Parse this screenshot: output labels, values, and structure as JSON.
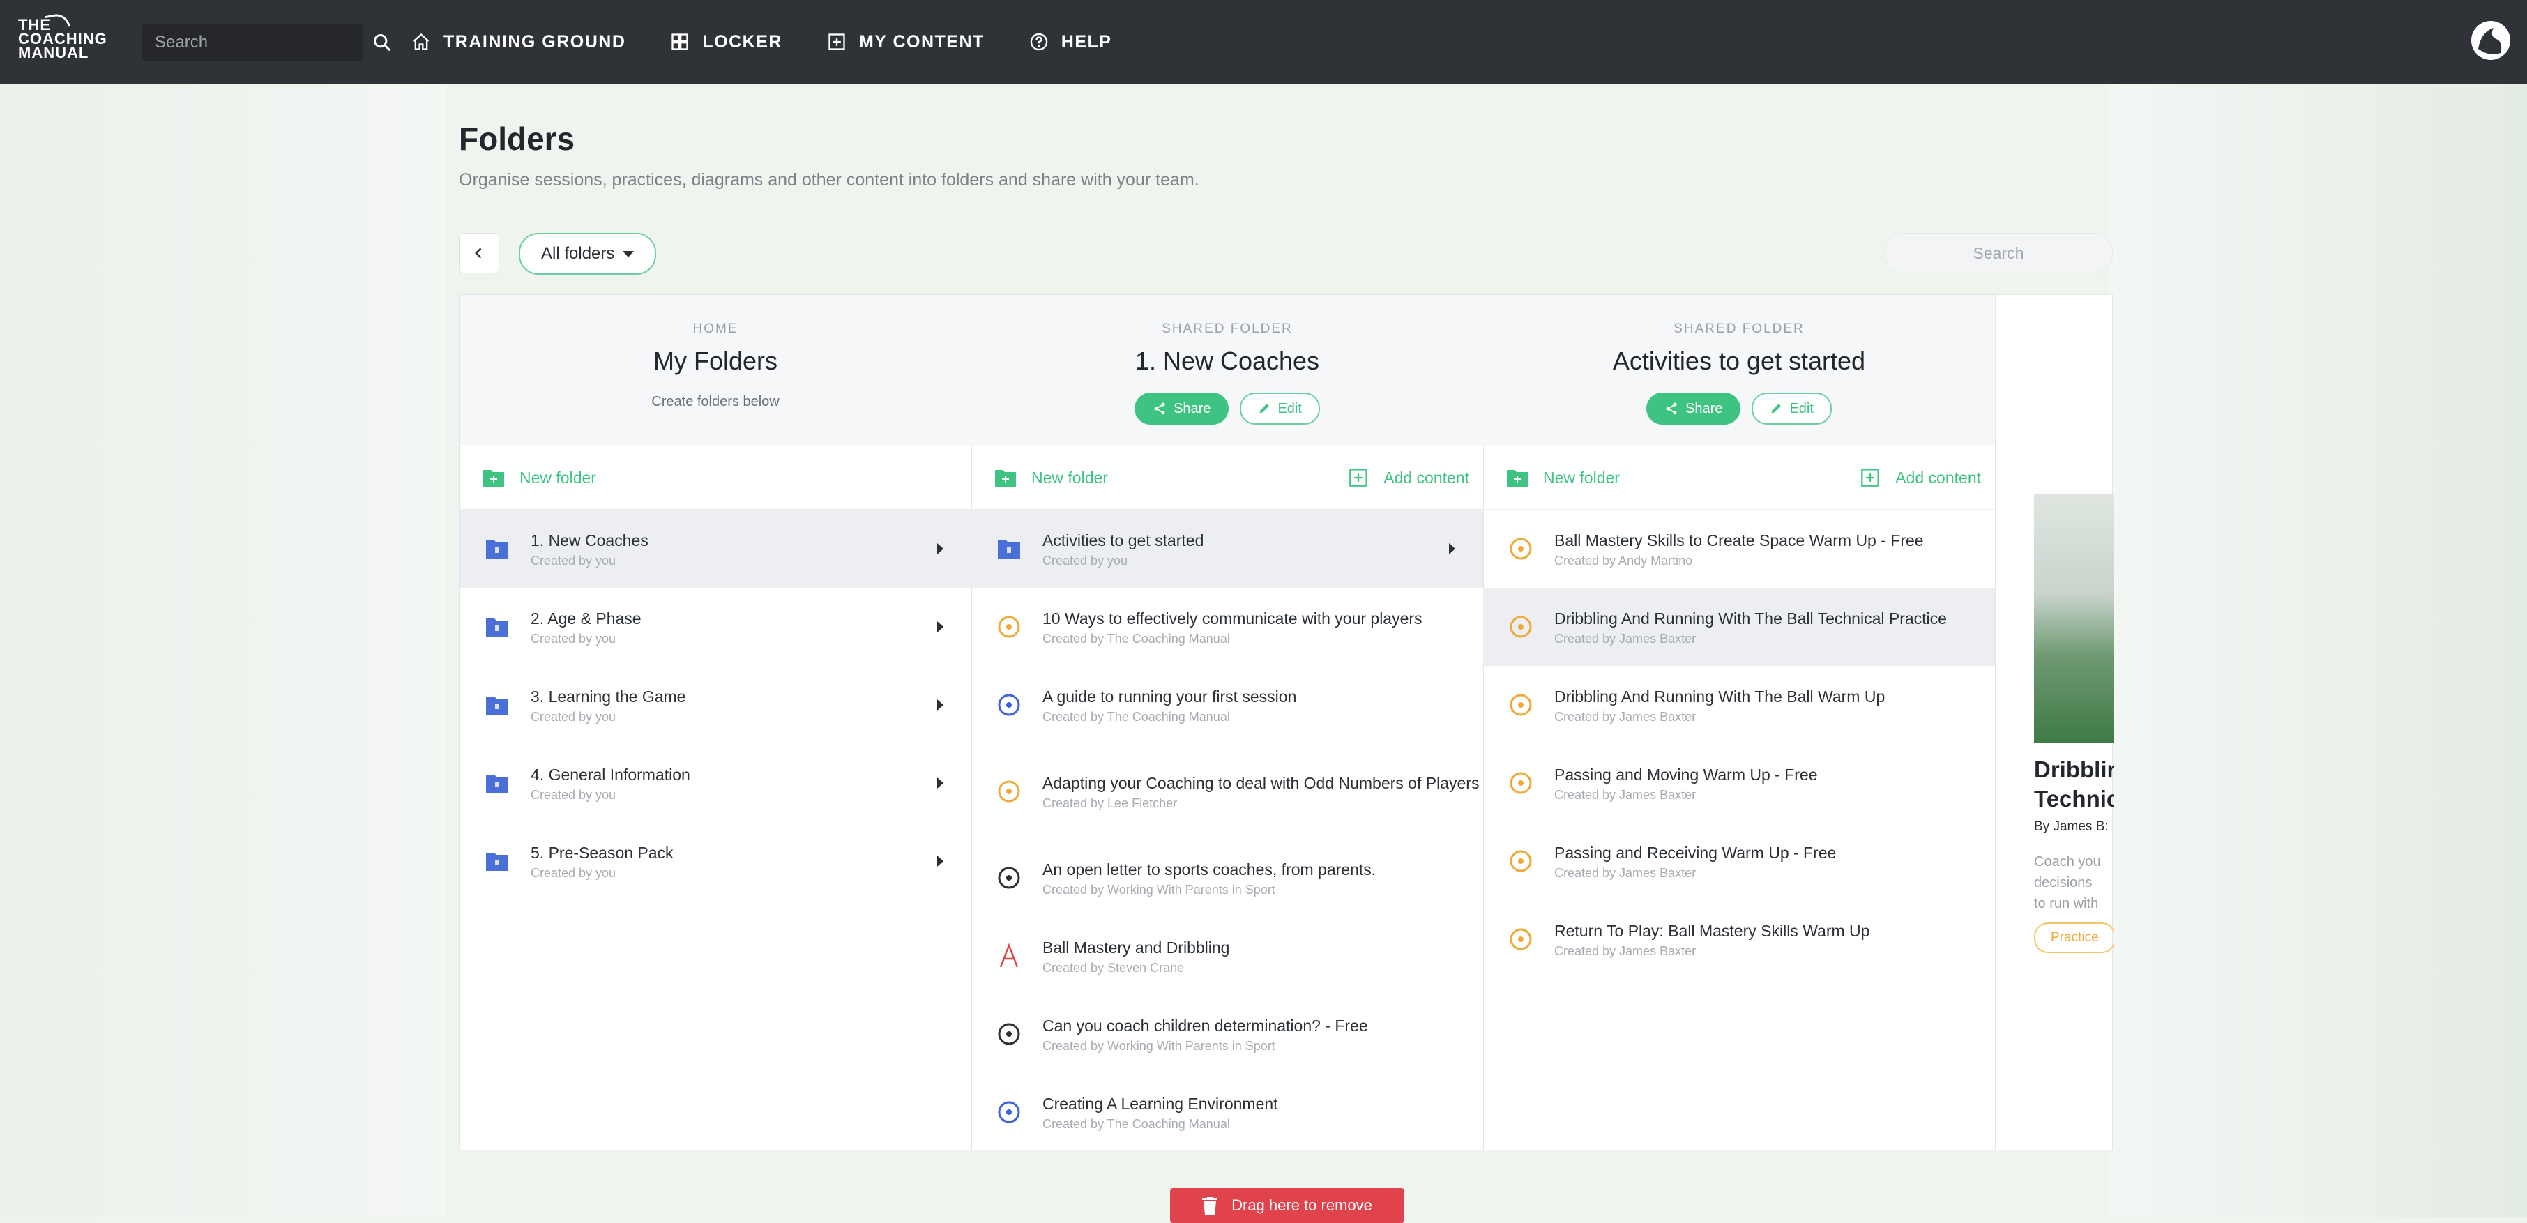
{
  "app": {
    "logo_text_1": "THE",
    "logo_text_2": "COACHING",
    "logo_text_3": "MANUAL",
    "search_placeholder": "Search"
  },
  "nav": [
    {
      "label": "TRAINING GROUND",
      "icon": "home-icon"
    },
    {
      "label": "LOCKER",
      "icon": "locker-icon"
    },
    {
      "label": "MY CONTENT",
      "icon": "plus-box-icon"
    },
    {
      "label": "HELP",
      "icon": "help-icon"
    }
  ],
  "page": {
    "title": "Folders",
    "subtitle": "Organise sessions, practices, diagrams and other content into folders and share with your team.",
    "folder_filter": "All folders",
    "search_placeholder": "Search"
  },
  "colors": {
    "accent": "#3ec383",
    "practice": "#f0a93b",
    "danger": "#e0434b",
    "folder": "#4a6fd6"
  },
  "columns": [
    {
      "kicker": "HOME",
      "title": "My Folders",
      "note": "Create folders below",
      "new_folder": "New folder",
      "items": [
        {
          "name": "1. New Coaches",
          "by": "Created by you",
          "type": "folder",
          "arrow": true,
          "active": true
        },
        {
          "name": "2. Age & Phase",
          "by": "Created by you",
          "type": "folder",
          "arrow": true
        },
        {
          "name": "3. Learning the Game",
          "by": "Created by you",
          "type": "folder",
          "arrow": true
        },
        {
          "name": "4. General Information",
          "by": "Created by you",
          "type": "folder",
          "arrow": true
        },
        {
          "name": "5. Pre-Season Pack",
          "by": "Created by you",
          "type": "folder",
          "arrow": true
        }
      ]
    },
    {
      "kicker": "SHARED FOLDER",
      "title": "1. New Coaches",
      "share": "Share",
      "edit": "Edit",
      "new_folder": "New folder",
      "add_content": "Add content",
      "items": [
        {
          "name": "Activities to get started",
          "by": "Created by you",
          "type": "folder",
          "arrow": true,
          "active": true
        },
        {
          "name": "10 Ways to effectively communicate with your players",
          "by": "Created by The Coaching Manual",
          "type": "practice"
        },
        {
          "name": "A guide to running your first session",
          "by": "Created by The Coaching Manual",
          "type": "article"
        },
        {
          "name": "Adapting your Coaching to deal with Odd Numbers of Players",
          "by": "Created by Lee Fletcher",
          "type": "practice",
          "tall": true
        },
        {
          "name": "An open letter to sports coaches, from parents.",
          "by": "Created by Working With Parents in Sport",
          "type": "dark"
        },
        {
          "name": "Ball Mastery and Dribbling",
          "by": "Created by Steven Crane",
          "type": "letter"
        },
        {
          "name": "Can you coach children determination? - Free",
          "by": "Created by Working With Parents in Sport",
          "type": "dark"
        },
        {
          "name": "Creating A Learning Environment",
          "by": "Created by The Coaching Manual",
          "type": "article"
        }
      ]
    },
    {
      "kicker": "SHARED FOLDER",
      "title": "Activities to get started",
      "share": "Share",
      "edit": "Edit",
      "new_folder": "New folder",
      "add_content": "Add content",
      "items": [
        {
          "name": "Ball Mastery Skills to Create Space Warm Up - Free",
          "by": "Created by Andy Martino",
          "type": "practice"
        },
        {
          "name": "Dribbling And Running With The Ball Technical Practice",
          "by": "Created by James Baxter",
          "type": "practice",
          "active": true
        },
        {
          "name": "Dribbling And Running With The Ball Warm Up",
          "by": "Created by James Baxter",
          "type": "practice"
        },
        {
          "name": "Passing and Moving Warm Up - Free",
          "by": "Created by James Baxter",
          "type": "practice"
        },
        {
          "name": "Passing and Receiving Warm Up - Free",
          "by": "Created by James Baxter",
          "type": "practice"
        },
        {
          "name": "Return To Play: Ball Mastery Skills Warm Up",
          "by": "Created by James Baxter",
          "type": "practice"
        }
      ]
    }
  ],
  "preview": {
    "title_1": "Dribblir",
    "title_2": "Technic",
    "by": "By James B:",
    "desc_1": "Coach you",
    "desc_2": "decisions",
    "desc_3": "to run with",
    "tag": "Practice"
  },
  "remove_label": "Drag here to remove"
}
